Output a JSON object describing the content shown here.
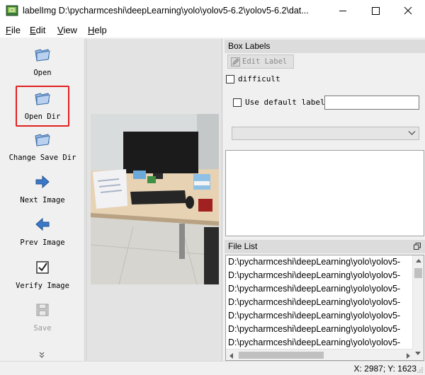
{
  "window": {
    "title": "labelImg D:\\pycharmceshi\\deepLearning\\yolo\\yolov5-6.2\\yolov5-6.2\\dat...",
    "controls": [
      "minimize-icon",
      "maximize-icon",
      "close-icon"
    ]
  },
  "menu": {
    "file": {
      "mnemonic": "F",
      "rest": "ile"
    },
    "edit": {
      "mnemonic": "E",
      "rest": "dit"
    },
    "view": {
      "mnemonic": "V",
      "rest": "iew"
    },
    "help": {
      "mnemonic": "H",
      "rest": "elp"
    }
  },
  "toolbar": {
    "open": "Open",
    "open_dir": "Open Dir",
    "change_save_dir": "Change Save Dir",
    "next_image": "Next Image",
    "prev_image": "Prev Image",
    "verify_image": "Verify Image",
    "save": "Save",
    "more": "»"
  },
  "box_labels": {
    "header": "Box Labels",
    "edit_label": "Edit Label",
    "difficult": "difficult",
    "use_default_label": "Use default label",
    "default_label_value": "",
    "combo_value": ""
  },
  "file_list": {
    "header": "File List",
    "items": [
      "D:\\pycharmceshi\\deepLearning\\yolo\\yolov5-",
      "D:\\pycharmceshi\\deepLearning\\yolo\\yolov5-",
      "D:\\pycharmceshi\\deepLearning\\yolo\\yolov5-",
      "D:\\pycharmceshi\\deepLearning\\yolo\\yolov5-",
      "D:\\pycharmceshi\\deepLearning\\yolo\\yolov5-",
      "D:\\pycharmceshi\\deepLearning\\yolo\\yolov5-",
      "D:\\pycharmceshi\\deepLearning\\yolo\\yolov5-"
    ]
  },
  "status": {
    "coords": "X: 2987; Y: 1623"
  },
  "colors": {
    "highlight_box": "#e02020",
    "folder_blue": "#6a95c8",
    "arrow_blue": "#3a79c9"
  }
}
